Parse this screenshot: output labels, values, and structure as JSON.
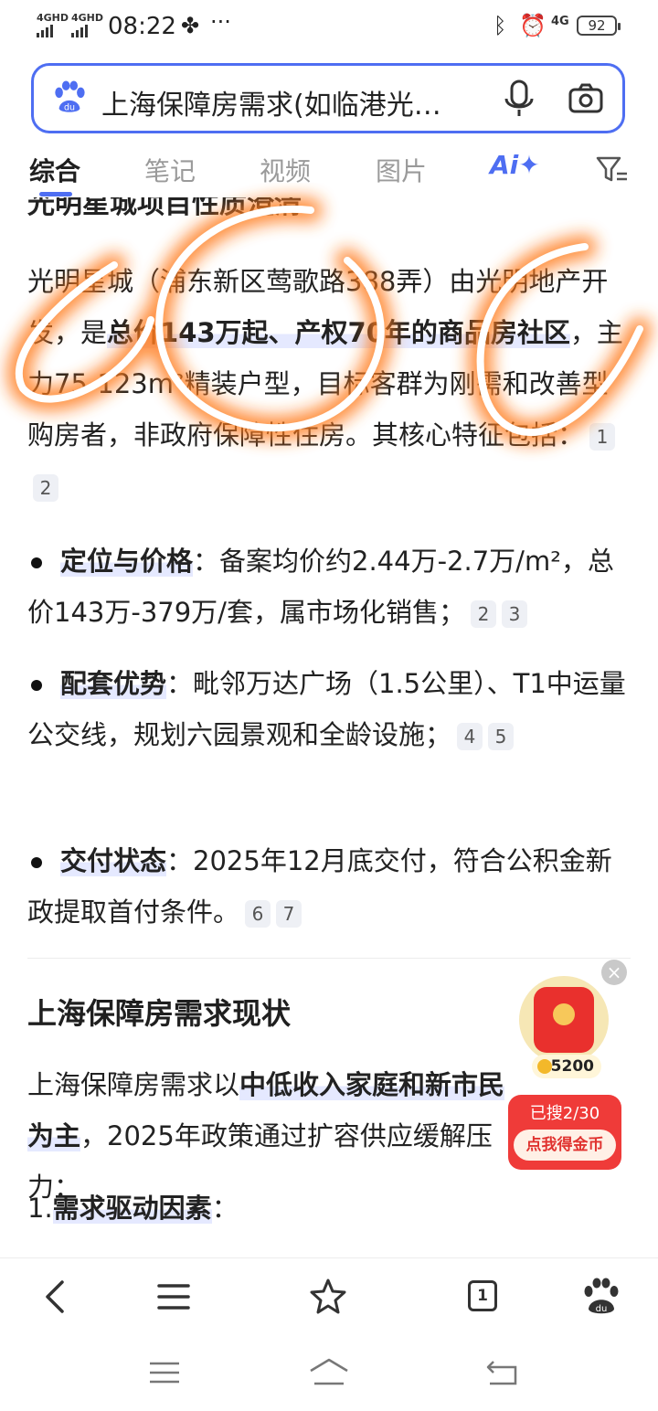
{
  "status_bar": {
    "signal1": "4GHD",
    "signal2": "4GHD",
    "time": "08:22",
    "more": "···",
    "network": "4G",
    "battery": "92"
  },
  "search": {
    "query": "上海保障房需求(如临港光…",
    "brand_color": "#4e6ef2"
  },
  "tabs": [
    {
      "label": "综合",
      "active": true
    },
    {
      "label": "笔记"
    },
    {
      "label": "视频"
    },
    {
      "label": "图片"
    }
  ],
  "ai_tab": "Ai✦",
  "content": {
    "cut_heading": "光明星城项目性质澄清",
    "intro": {
      "part1": "光明星城（浦东新区莺歌路388弄）由光明地产开发，是",
      "highlight": "总价143万起、产权70年的商品房社区",
      "part2": "，主力75-123m²精装户型，目标客群为刚需和改善型购房者，非政府保障性住房。其核心特征包括：",
      "cites": [
        "1",
        "2"
      ]
    },
    "bullets": [
      {
        "title": "定位与价格",
        "text": "：备案均价约2.44万-2.7万/m²，总价143万-379万/套，属市场化销售；",
        "cites": [
          "2",
          "3"
        ]
      },
      {
        "title": "配套优势",
        "text": "：毗邻万达广场（1.5公里）、T1中运量公交线，规划六园景观和全龄设施；",
        "cites": [
          "4",
          "5"
        ]
      },
      {
        "title": "交付状态",
        "text": "：2025年12月底交付，符合公积金新政提取首付条件。",
        "cites": [
          "6",
          "7"
        ]
      }
    ],
    "section_title": "上海保障房需求现状",
    "section_para": {
      "part1": "上海保障房需求以",
      "highlight": "中低收入家庭和新市民为主",
      "part2": "，2025年政策通过扩容供应缓解压力："
    },
    "numbered": {
      "num": "1.",
      "title": "需求驱动因素",
      "tail": "："
    }
  },
  "floating": {
    "close": "×",
    "coins": "5200",
    "progress": "已搜2/30",
    "cta": "点我得金币"
  },
  "bottom_nav": {
    "tab_count": "1"
  }
}
